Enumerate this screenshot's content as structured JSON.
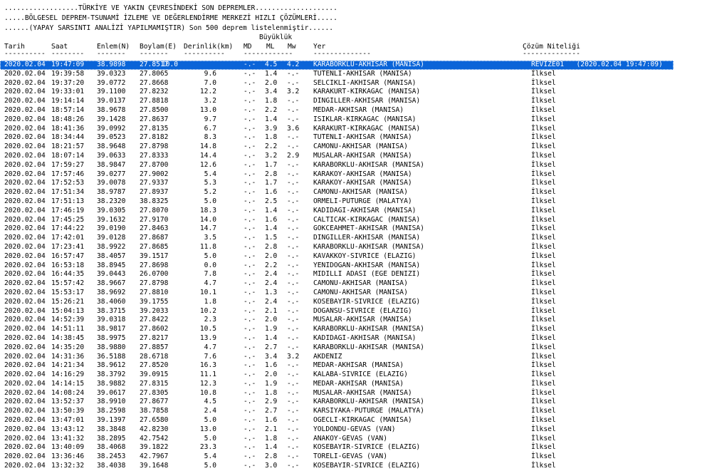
{
  "header": {
    "line1": "..................TÜRKİYE VE YAKIN ÇEVRESİNDEKİ SON DEPREMLER....................",
    "line2": ".....BÖLGESEL DEPREM-TSUNAMİ İZLEME VE DEĞERLENDİRME MERKEZİ HIZLI ÇÖZÜMLERİ.....",
    "line3": "......(YAPAY SARSINTI ANALİZİ YAPILMAMIŞTIR) Son 500 deprem listelenmiştir......",
    "buyukluk": "Büyüklük"
  },
  "columns": {
    "tarih": "Tarih",
    "saat": "Saat",
    "enlem": "Enlem(N)",
    "boylam": "Boylam(E)",
    "derinlik": "Derinlik(km)",
    "md": "MD",
    "ml": "ML",
    "mw": "Mw",
    "yer": "Yer",
    "cozum": "Çözüm Niteliği"
  },
  "dashes": {
    "tarih": "----------",
    "saat": "--------",
    "enlem": "-------",
    "boylam": "-------",
    "derinlik": "----------",
    "mag": "------------",
    "yer": "--------------",
    "cozum": "--------------"
  },
  "rows": [
    {
      "d": "2020.02.04",
      "t": "19:47:09",
      "lat": "38.9898",
      "lon": "27.8517",
      "dep": "10.0",
      "md": "-.-",
      "ml": "4.5",
      "mw": "4.2",
      "loc": "KARABORKLU-AKHISAR (MANISA)",
      "q": "REVIZE01   (2020.02.04 19:47:09)"
    },
    {
      "d": "2020.02.04",
      "t": "19:39:58",
      "lat": "39.0323",
      "lon": "27.8065",
      "dep": "9.6",
      "md": "-.-",
      "ml": "1.4",
      "mw": "-.-",
      "loc": "TUTENLI-AKHISAR (MANISA)",
      "q": "İlksel"
    },
    {
      "d": "2020.02.04",
      "t": "19:37:20",
      "lat": "39.0772",
      "lon": "27.8668",
      "dep": "7.0",
      "md": "-.-",
      "ml": "2.0",
      "mw": "-.-",
      "loc": "SELCIKLI-AKHISAR (MANISA)",
      "q": "İlksel"
    },
    {
      "d": "2020.02.04",
      "t": "19:33:01",
      "lat": "39.1100",
      "lon": "27.8232",
      "dep": "12.2",
      "md": "-.-",
      "ml": "3.4",
      "mw": "3.2",
      "loc": "KARAKURT-KIRKAGAC (MANISA)",
      "q": "İlksel"
    },
    {
      "d": "2020.02.04",
      "t": "19:14:14",
      "lat": "39.0137",
      "lon": "27.8818",
      "dep": "3.2",
      "md": "-.-",
      "ml": "1.8",
      "mw": "-.-",
      "loc": "DINGILLER-AKHISAR (MANISA)",
      "q": "İlksel"
    },
    {
      "d": "2020.02.04",
      "t": "18:57:14",
      "lat": "38.9678",
      "lon": "27.8500",
      "dep": "13.0",
      "md": "-.-",
      "ml": "2.2",
      "mw": "-.-",
      "loc": "MEDAR-AKHISAR (MANISA)",
      "q": "İlksel"
    },
    {
      "d": "2020.02.04",
      "t": "18:48:26",
      "lat": "39.1428",
      "lon": "27.8637",
      "dep": "9.7",
      "md": "-.-",
      "ml": "1.4",
      "mw": "-.-",
      "loc": "ISIKLAR-KIRKAGAC (MANISA)",
      "q": "İlksel"
    },
    {
      "d": "2020.02.04",
      "t": "18:41:36",
      "lat": "39.0992",
      "lon": "27.8135",
      "dep": "6.7",
      "md": "-.-",
      "ml": "3.9",
      "mw": "3.6",
      "loc": "KARAKURT-KIRKAGAC (MANISA)",
      "q": "İlksel"
    },
    {
      "d": "2020.02.04",
      "t": "18:34:44",
      "lat": "39.0523",
      "lon": "27.8182",
      "dep": "8.3",
      "md": "-.-",
      "ml": "1.8",
      "mw": "-.-",
      "loc": "TUTENLI-AKHISAR (MANISA)",
      "q": "İlksel"
    },
    {
      "d": "2020.02.04",
      "t": "18:21:57",
      "lat": "38.9648",
      "lon": "27.8798",
      "dep": "14.8",
      "md": "-.-",
      "ml": "2.2",
      "mw": "-.-",
      "loc": "CAMONU-AKHISAR (MANISA)",
      "q": "İlksel"
    },
    {
      "d": "2020.02.04",
      "t": "18:07:14",
      "lat": "39.0633",
      "lon": "27.8333",
      "dep": "14.4",
      "md": "-.-",
      "ml": "3.2",
      "mw": "2.9",
      "loc": "MUSALAR-AKHISAR (MANISA)",
      "q": "İlksel"
    },
    {
      "d": "2020.02.04",
      "t": "17:59:27",
      "lat": "38.9847",
      "lon": "27.8700",
      "dep": "12.6",
      "md": "-.-",
      "ml": "1.7",
      "mw": "-.-",
      "loc": "KARABORKLU-AKHISAR (MANISA)",
      "q": "İlksel"
    },
    {
      "d": "2020.02.04",
      "t": "17:57:46",
      "lat": "39.0277",
      "lon": "27.9002",
      "dep": "5.4",
      "md": "-.-",
      "ml": "2.8",
      "mw": "-.-",
      "loc": "KARAKOY-AKHISAR (MANISA)",
      "q": "İlksel"
    },
    {
      "d": "2020.02.04",
      "t": "17:52:53",
      "lat": "39.0078",
      "lon": "27.9337",
      "dep": "5.3",
      "md": "-.-",
      "ml": "1.7",
      "mw": "-.-",
      "loc": "KARAKOY-AKHISAR (MANISA)",
      "q": "İlksel"
    },
    {
      "d": "2020.02.04",
      "t": "17:51:34",
      "lat": "38.9787",
      "lon": "27.8937",
      "dep": "5.2",
      "md": "-.-",
      "ml": "1.6",
      "mw": "-.-",
      "loc": "CAMONU-AKHISAR (MANISA)",
      "q": "İlksel"
    },
    {
      "d": "2020.02.04",
      "t": "17:51:13",
      "lat": "38.2320",
      "lon": "38.8325",
      "dep": "5.0",
      "md": "-.-",
      "ml": "2.5",
      "mw": "-.-",
      "loc": "ORMELI-PUTURGE (MALATYA)",
      "q": "İlksel"
    },
    {
      "d": "2020.02.04",
      "t": "17:46:19",
      "lat": "39.0305",
      "lon": "27.8070",
      "dep": "18.3",
      "md": "-.-",
      "ml": "1.4",
      "mw": "-.-",
      "loc": "KADIDAGI-AKHISAR (MANISA)",
      "q": "İlksel"
    },
    {
      "d": "2020.02.04",
      "t": "17:45:25",
      "lat": "39.1632",
      "lon": "27.9170",
      "dep": "14.0",
      "md": "-.-",
      "ml": "1.6",
      "mw": "-.-",
      "loc": "CALTICAK-KIRKAGAC (MANISA)",
      "q": "İlksel"
    },
    {
      "d": "2020.02.04",
      "t": "17:44:22",
      "lat": "39.0190",
      "lon": "27.8463",
      "dep": "14.7",
      "md": "-.-",
      "ml": "1.4",
      "mw": "-.-",
      "loc": "GOKCEAHMET-AKHISAR (MANISA)",
      "q": "İlksel"
    },
    {
      "d": "2020.02.04",
      "t": "17:42:01",
      "lat": "39.0128",
      "lon": "27.8687",
      "dep": "3.5",
      "md": "-.-",
      "ml": "1.5",
      "mw": "-.-",
      "loc": "DINGILLER-AKHISAR (MANISA)",
      "q": "İlksel"
    },
    {
      "d": "2020.02.04",
      "t": "17:23:41",
      "lat": "38.9922",
      "lon": "27.8685",
      "dep": "11.8",
      "md": "-.-",
      "ml": "2.8",
      "mw": "-.-",
      "loc": "KARABORKLU-AKHISAR (MANISA)",
      "q": "İlksel"
    },
    {
      "d": "2020.02.04",
      "t": "16:57:47",
      "lat": "38.4057",
      "lon": "39.1517",
      "dep": "5.0",
      "md": "-.-",
      "ml": "2.0",
      "mw": "-.-",
      "loc": "KAVAKKOY-SIVRICE (ELAZIG)",
      "q": "İlksel"
    },
    {
      "d": "2020.02.04",
      "t": "16:53:18",
      "lat": "38.8945",
      "lon": "27.8698",
      "dep": "0.0",
      "md": "-.-",
      "ml": "2.2",
      "mw": "-.-",
      "loc": "YENIDOGAN-AKHISAR (MANISA)",
      "q": "İlksel"
    },
    {
      "d": "2020.02.04",
      "t": "16:44:35",
      "lat": "39.0443",
      "lon": "26.0700",
      "dep": "7.8",
      "md": "-.-",
      "ml": "2.4",
      "mw": "-.-",
      "loc": "MIDILLI ADASI (EGE DENIZI)",
      "q": "İlksel"
    },
    {
      "d": "2020.02.04",
      "t": "15:57:42",
      "lat": "38.9667",
      "lon": "27.8798",
      "dep": "4.7",
      "md": "-.-",
      "ml": "2.4",
      "mw": "-.-",
      "loc": "CAMONU-AKHISAR (MANISA)",
      "q": "İlksel"
    },
    {
      "d": "2020.02.04",
      "t": "15:53:17",
      "lat": "38.9692",
      "lon": "27.8810",
      "dep": "10.1",
      "md": "-.-",
      "ml": "1.3",
      "mw": "-.-",
      "loc": "CAMONU-AKHISAR (MANISA)",
      "q": "İlksel"
    },
    {
      "d": "2020.02.04",
      "t": "15:26:21",
      "lat": "38.4060",
      "lon": "39.1755",
      "dep": "1.8",
      "md": "-.-",
      "ml": "2.4",
      "mw": "-.-",
      "loc": "KOSEBAYIR-SIVRICE (ELAZIG)",
      "q": "İlksel"
    },
    {
      "d": "2020.02.04",
      "t": "15:04:13",
      "lat": "38.3715",
      "lon": "39.2033",
      "dep": "10.2",
      "md": "-.-",
      "ml": "2.1",
      "mw": "-.-",
      "loc": "DOGANSU-SIVRICE (ELAZIG)",
      "q": "İlksel"
    },
    {
      "d": "2020.02.04",
      "t": "14:52:39",
      "lat": "39.0318",
      "lon": "27.8422",
      "dep": "2.3",
      "md": "-.-",
      "ml": "2.0",
      "mw": "-.-",
      "loc": "MUSALAR-AKHISAR (MANISA)",
      "q": "İlksel"
    },
    {
      "d": "2020.02.04",
      "t": "14:51:11",
      "lat": "38.9817",
      "lon": "27.8602",
      "dep": "10.5",
      "md": "-.-",
      "ml": "1.9",
      "mw": "-.-",
      "loc": "KARABORKLU-AKHISAR (MANISA)",
      "q": "İlksel"
    },
    {
      "d": "2020.02.04",
      "t": "14:38:45",
      "lat": "38.9975",
      "lon": "27.8217",
      "dep": "13.9",
      "md": "-.-",
      "ml": "1.4",
      "mw": "-.-",
      "loc": "KADIDAGI-AKHISAR (MANISA)",
      "q": "İlksel"
    },
    {
      "d": "2020.02.04",
      "t": "14:35:20",
      "lat": "38.9880",
      "lon": "27.8857",
      "dep": "4.7",
      "md": "-.-",
      "ml": "2.7",
      "mw": "-.-",
      "loc": "KARABORKLU-AKHISAR (MANISA)",
      "q": "İlksel"
    },
    {
      "d": "2020.02.04",
      "t": "14:31:36",
      "lat": "36.5188",
      "lon": "28.6718",
      "dep": "7.6",
      "md": "-.-",
      "ml": "3.4",
      "mw": "3.2",
      "loc": "AKDENIZ",
      "q": "İlksel"
    },
    {
      "d": "2020.02.04",
      "t": "14:21:34",
      "lat": "38.9612",
      "lon": "27.8520",
      "dep": "16.3",
      "md": "-.-",
      "ml": "1.6",
      "mw": "-.-",
      "loc": "MEDAR-AKHISAR (MANISA)",
      "q": "İlksel"
    },
    {
      "d": "2020.02.04",
      "t": "14:16:29",
      "lat": "38.3792",
      "lon": "39.0915",
      "dep": "11.1",
      "md": "-.-",
      "ml": "2.0",
      "mw": "-.-",
      "loc": "KALABA-SIVRICE (ELAZIG)",
      "q": "İlksel"
    },
    {
      "d": "2020.02.04",
      "t": "14:14:15",
      "lat": "38.9882",
      "lon": "27.8315",
      "dep": "12.3",
      "md": "-.-",
      "ml": "1.9",
      "mw": "-.-",
      "loc": "MEDAR-AKHISAR (MANISA)",
      "q": "İlksel"
    },
    {
      "d": "2020.02.04",
      "t": "14:08:24",
      "lat": "39.0617",
      "lon": "27.8305",
      "dep": "10.8",
      "md": "-.-",
      "ml": "1.8",
      "mw": "-.-",
      "loc": "MUSALAR-AKHISAR (MANISA)",
      "q": "İlksel"
    },
    {
      "d": "2020.02.04",
      "t": "13:52:37",
      "lat": "38.9910",
      "lon": "27.8677",
      "dep": "4.5",
      "md": "-.-",
      "ml": "2.9",
      "mw": "-.-",
      "loc": "KARABORKLU-AKHISAR (MANISA)",
      "q": "İlksel"
    },
    {
      "d": "2020.02.04",
      "t": "13:50:39",
      "lat": "38.2598",
      "lon": "38.7858",
      "dep": "2.4",
      "md": "-.-",
      "ml": "2.7",
      "mw": "-.-",
      "loc": "KARSIYAKA-PUTURGE (MALATYA)",
      "q": "İlksel"
    },
    {
      "d": "2020.02.04",
      "t": "13:47:01",
      "lat": "39.1397",
      "lon": "27.6580",
      "dep": "5.0",
      "md": "-.-",
      "ml": "1.6",
      "mw": "-.-",
      "loc": "OGECLI-KIRKAGAC (MANISA)",
      "q": "İlksel"
    },
    {
      "d": "2020.02.04",
      "t": "13:43:12",
      "lat": "38.3848",
      "lon": "42.8230",
      "dep": "13.0",
      "md": "-.-",
      "ml": "2.1",
      "mw": "-.-",
      "loc": "YOLDONDU-GEVAS (VAN)",
      "q": "İlksel"
    },
    {
      "d": "2020.02.04",
      "t": "13:41:32",
      "lat": "38.2895",
      "lon": "42.7542",
      "dep": "5.0",
      "md": "-.-",
      "ml": "1.8",
      "mw": "-.-",
      "loc": "ANAKOY-GEVAS (VAN)",
      "q": "İlksel"
    },
    {
      "d": "2020.02.04",
      "t": "13:40:09",
      "lat": "38.4068",
      "lon": "39.1822",
      "dep": "23.3",
      "md": "-.-",
      "ml": "1.4",
      "mw": "-.-",
      "loc": "KOSEBAYIR-SIVRICE (ELAZIG)",
      "q": "İlksel"
    },
    {
      "d": "2020.02.04",
      "t": "13:36:46",
      "lat": "38.2453",
      "lat2": "",
      "lon": "42.7967",
      "dep": "5.4",
      "md": "-.-",
      "ml": "2.8",
      "mw": "-.-",
      "loc": "TORELI-GEVAS (VAN)",
      "q": "İlksel"
    },
    {
      "d": "2020.02.04",
      "t": "13:32:32",
      "lat": "38.4038",
      "lon": "39.1648",
      "dep": "5.0",
      "md": "-.-",
      "ml": "3.0",
      "mw": "-.-",
      "loc": "KOSEBAYIR-SIVRICE (ELAZIG)",
      "q": "İlksel"
    }
  ]
}
